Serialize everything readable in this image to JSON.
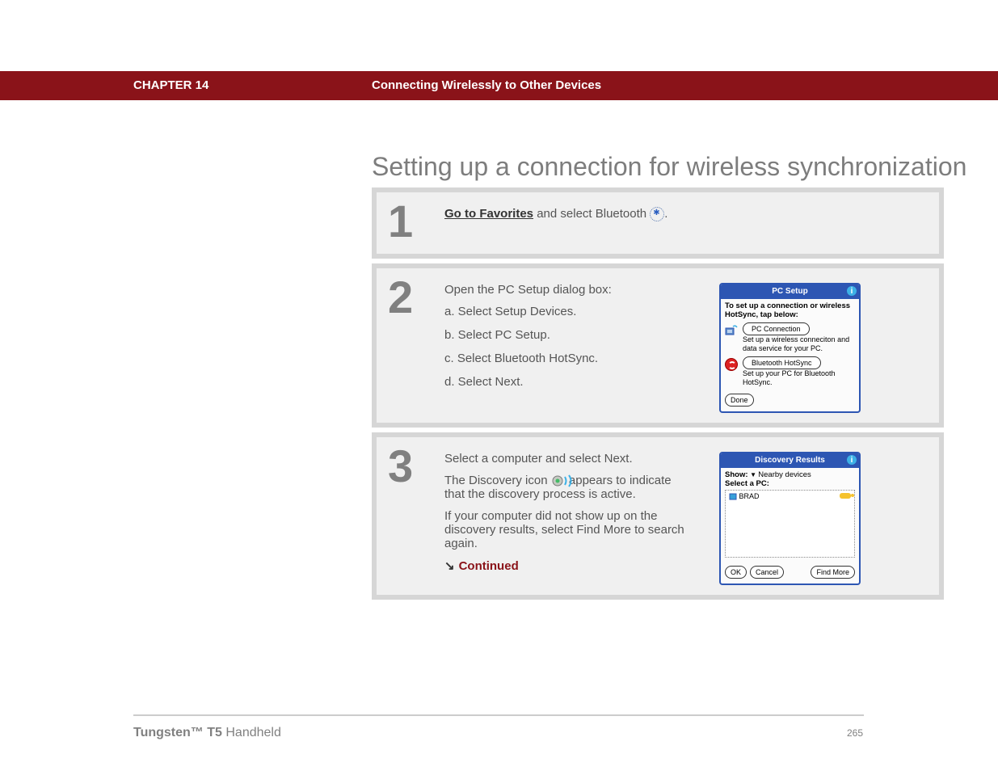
{
  "header": {
    "chapter": "CHAPTER 14",
    "title": "Connecting Wirelessly to Other Devices"
  },
  "heading": "Setting up a connection for wireless synchronization",
  "steps": {
    "s1": {
      "num": "1",
      "link_text": "Go to Favorites",
      "after_link": " and select Bluetooth ",
      "period": "."
    },
    "s2": {
      "num": "2",
      "intro": "Open the PC Setup dialog box:",
      "a": "a.  Select Setup Devices.",
      "b": "b.  Select PC Setup.",
      "c": "c.  Select Bluetooth HotSync.",
      "d": "d.  Select Next."
    },
    "s3": {
      "num": "3",
      "p1": "Select a computer and select Next.",
      "p2a": "The Discovery icon ",
      "p2b": " appears to indicate that the discovery process is active.",
      "p3": "If your computer did not show up on the discovery results, select Find More to search again.",
      "continued": "Continued"
    }
  },
  "palm_pc_setup": {
    "title": "PC Setup",
    "heading": "To set up a connection or wireless HotSync, tap below:",
    "btn1": "PC Connection",
    "desc1": "Set up a wireless conneciton and data service for your PC.",
    "btn2": "Bluetooth HotSync",
    "desc2": "Set up your PC for Bluetooth HotSync.",
    "done": "Done"
  },
  "palm_discovery": {
    "title": "Discovery Results",
    "show_label": "Show:",
    "show_value": "Nearby devices",
    "select_label": "Select a PC:",
    "item": "BRAD",
    "ok": "OK",
    "cancel": "Cancel",
    "find_more": "Find More"
  },
  "footer": {
    "brand_strong": "Tungsten™ T5",
    "brand_rest": " Handheld",
    "page": "265"
  }
}
